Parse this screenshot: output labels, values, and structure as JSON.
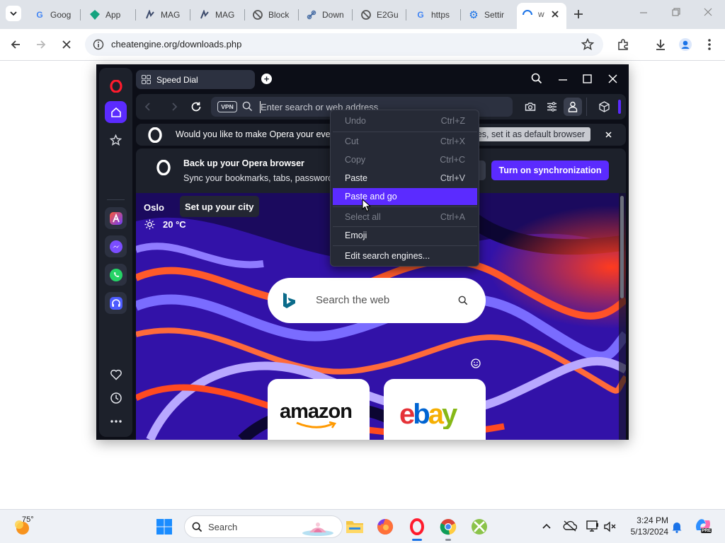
{
  "chrome": {
    "tabs": [
      {
        "label": "Goog",
        "icon": "google-icon"
      },
      {
        "label": "App",
        "icon": "app-gem-icon"
      },
      {
        "label": "MAG",
        "icon": "mag-icon"
      },
      {
        "label": "MAG",
        "icon": "mag-icon"
      },
      {
        "label": "Block",
        "icon": "block-icon"
      },
      {
        "label": "Down",
        "icon": "link-icon"
      },
      {
        "label": "E2Gu",
        "icon": "block-icon"
      },
      {
        "label": "https",
        "icon": "google-icon"
      },
      {
        "label": "Settir",
        "icon": "gear-icon"
      }
    ],
    "active_tab_label": "w",
    "url": "cheatengine.org/downloads.php",
    "colors": {
      "strip": "#dfe3e9",
      "accent": "#1a73e8"
    }
  },
  "opera": {
    "tab_title": "Speed Dial",
    "address_placeholder": "Enter search or web address",
    "vpn_label": "VPN",
    "default_prompt": "Would you like to make Opera your every",
    "default_action": "Yes, set it as default browser",
    "sync_title": "Back up your Opera browser",
    "sync_subtitle": "Sync your bookmarks, tabs, passwords",
    "sync_button": "Turn on synchronization",
    "weather": {
      "city": "Oslo",
      "setup_label": "Set up your city",
      "temp": "20 °C"
    },
    "search_placeholder": "Search the web",
    "tiles": [
      "amazon",
      "ebay"
    ],
    "colors": {
      "accent": "#5b2bff",
      "panel": "#1d212b"
    }
  },
  "context_menu": [
    {
      "label": "Undo",
      "shortcut": "Ctrl+Z",
      "enabled": false
    },
    {
      "label": "Cut",
      "shortcut": "Ctrl+X",
      "enabled": false
    },
    {
      "label": "Copy",
      "shortcut": "Ctrl+C",
      "enabled": false
    },
    {
      "label": "Paste",
      "shortcut": "Ctrl+V",
      "enabled": true
    },
    {
      "label": "Paste and go",
      "shortcut": "",
      "enabled": true,
      "highlighted": true
    },
    {
      "label": "Select all",
      "shortcut": "Ctrl+A",
      "enabled": false
    },
    {
      "label": "Emoji",
      "shortcut": "",
      "enabled": true
    },
    {
      "label": "Edit search engines...",
      "shortcut": "",
      "enabled": true
    }
  ],
  "taskbar": {
    "weather_temp": "75°",
    "search_label": "Search",
    "time": "3:24 PM",
    "date": "5/13/2024",
    "pre_badge": "PRE"
  }
}
